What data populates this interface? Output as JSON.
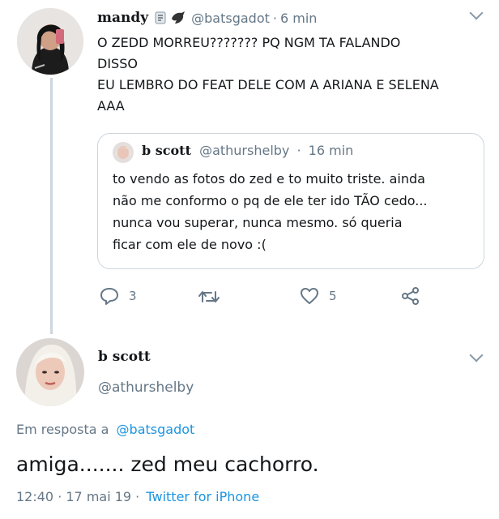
{
  "tweet1": {
    "display_name": "mandy",
    "handle": "@batsgadot",
    "sep": "·",
    "time": "6 min",
    "lines": [
      "O ZEDD MORREU??????? PQ NGM TA FALANDO",
      "DISSO",
      "EU LEMBRO DO FEAT DELE COM A ARIANA E SELENA",
      "AAA"
    ],
    "quote": {
      "display_name": "b scott",
      "handle": "@athurshelby",
      "sep": "·",
      "time": "16 min",
      "lines": [
        "to vendo as fotos do zed e to muito triste. ainda",
        "não me conformo o pq de ele ter ido TÃO cedo...",
        "nunca vou superar, nunca mesmo. só queria",
        "ficar com ele de novo :("
      ]
    },
    "actions": {
      "reply_count": "3",
      "retweet_count": "",
      "like_count": "5"
    }
  },
  "tweet2": {
    "display_name": "b scott",
    "handle": "@athurshelby",
    "reply_to_prefix": "Em resposta a",
    "reply_to_handle": "@batsgadot",
    "body": "amiga....... zed meu cachorro.",
    "timestamp": "12:40 · 17 mai 19 ·",
    "source": "Twitter for iPhone"
  },
  "colors": {
    "link": "#1b95e0",
    "muted": "#657786",
    "line": "#ccd6dd"
  },
  "icons": [
    "reply-icon",
    "retweet-icon",
    "like-icon",
    "share-icon",
    "chevron-down-icon",
    "badge-icon",
    "bird-icon"
  ]
}
